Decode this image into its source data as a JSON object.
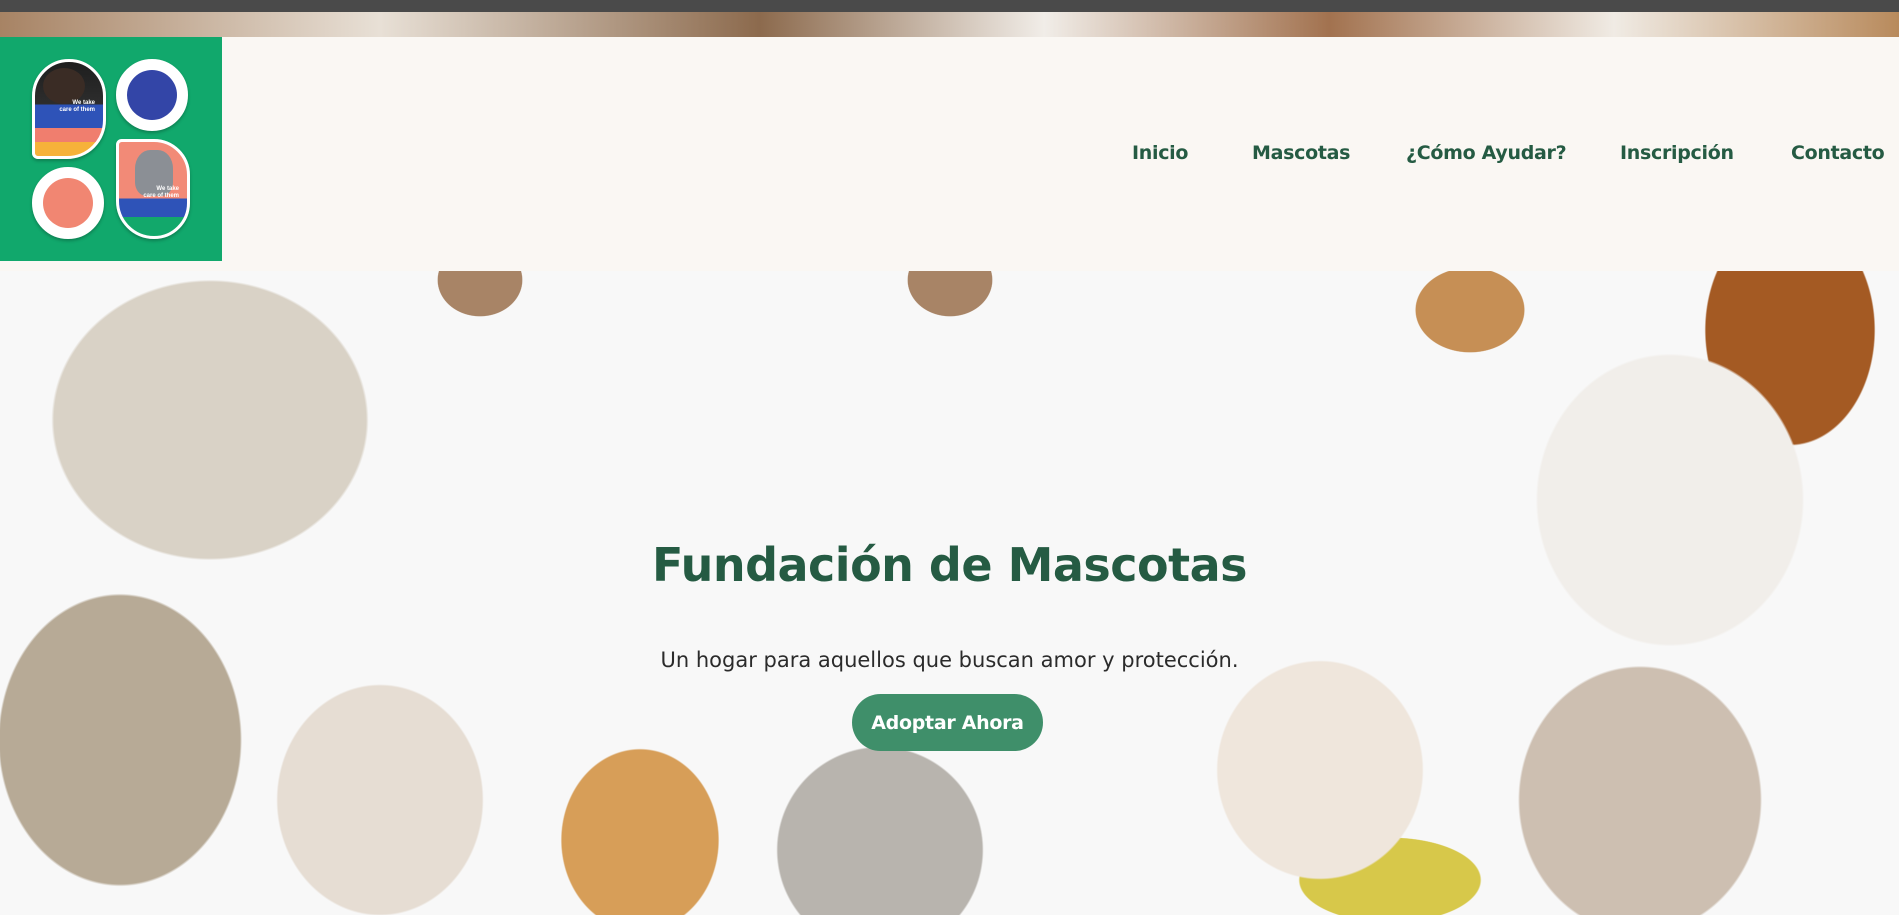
{
  "logo": {
    "badge_text_1": "We take care of them",
    "badge_text_2": "We take care of them"
  },
  "nav": {
    "items": [
      {
        "label": "Inicio"
      },
      {
        "label": "Mascotas"
      },
      {
        "label": "¿Cómo Ayudar?"
      },
      {
        "label": "Inscripción"
      },
      {
        "label": "Contacto"
      }
    ]
  },
  "hero": {
    "title": "Fundación de Mascotas",
    "subtitle": "Un hogar para aquellos que buscan amor y protección.",
    "cta_label": "Adoptar Ahora"
  },
  "colors": {
    "brand_green": "#255b43",
    "logo_background": "#11a86c",
    "button_green": "#3f8f6a",
    "header_background": "#faf7f3"
  }
}
